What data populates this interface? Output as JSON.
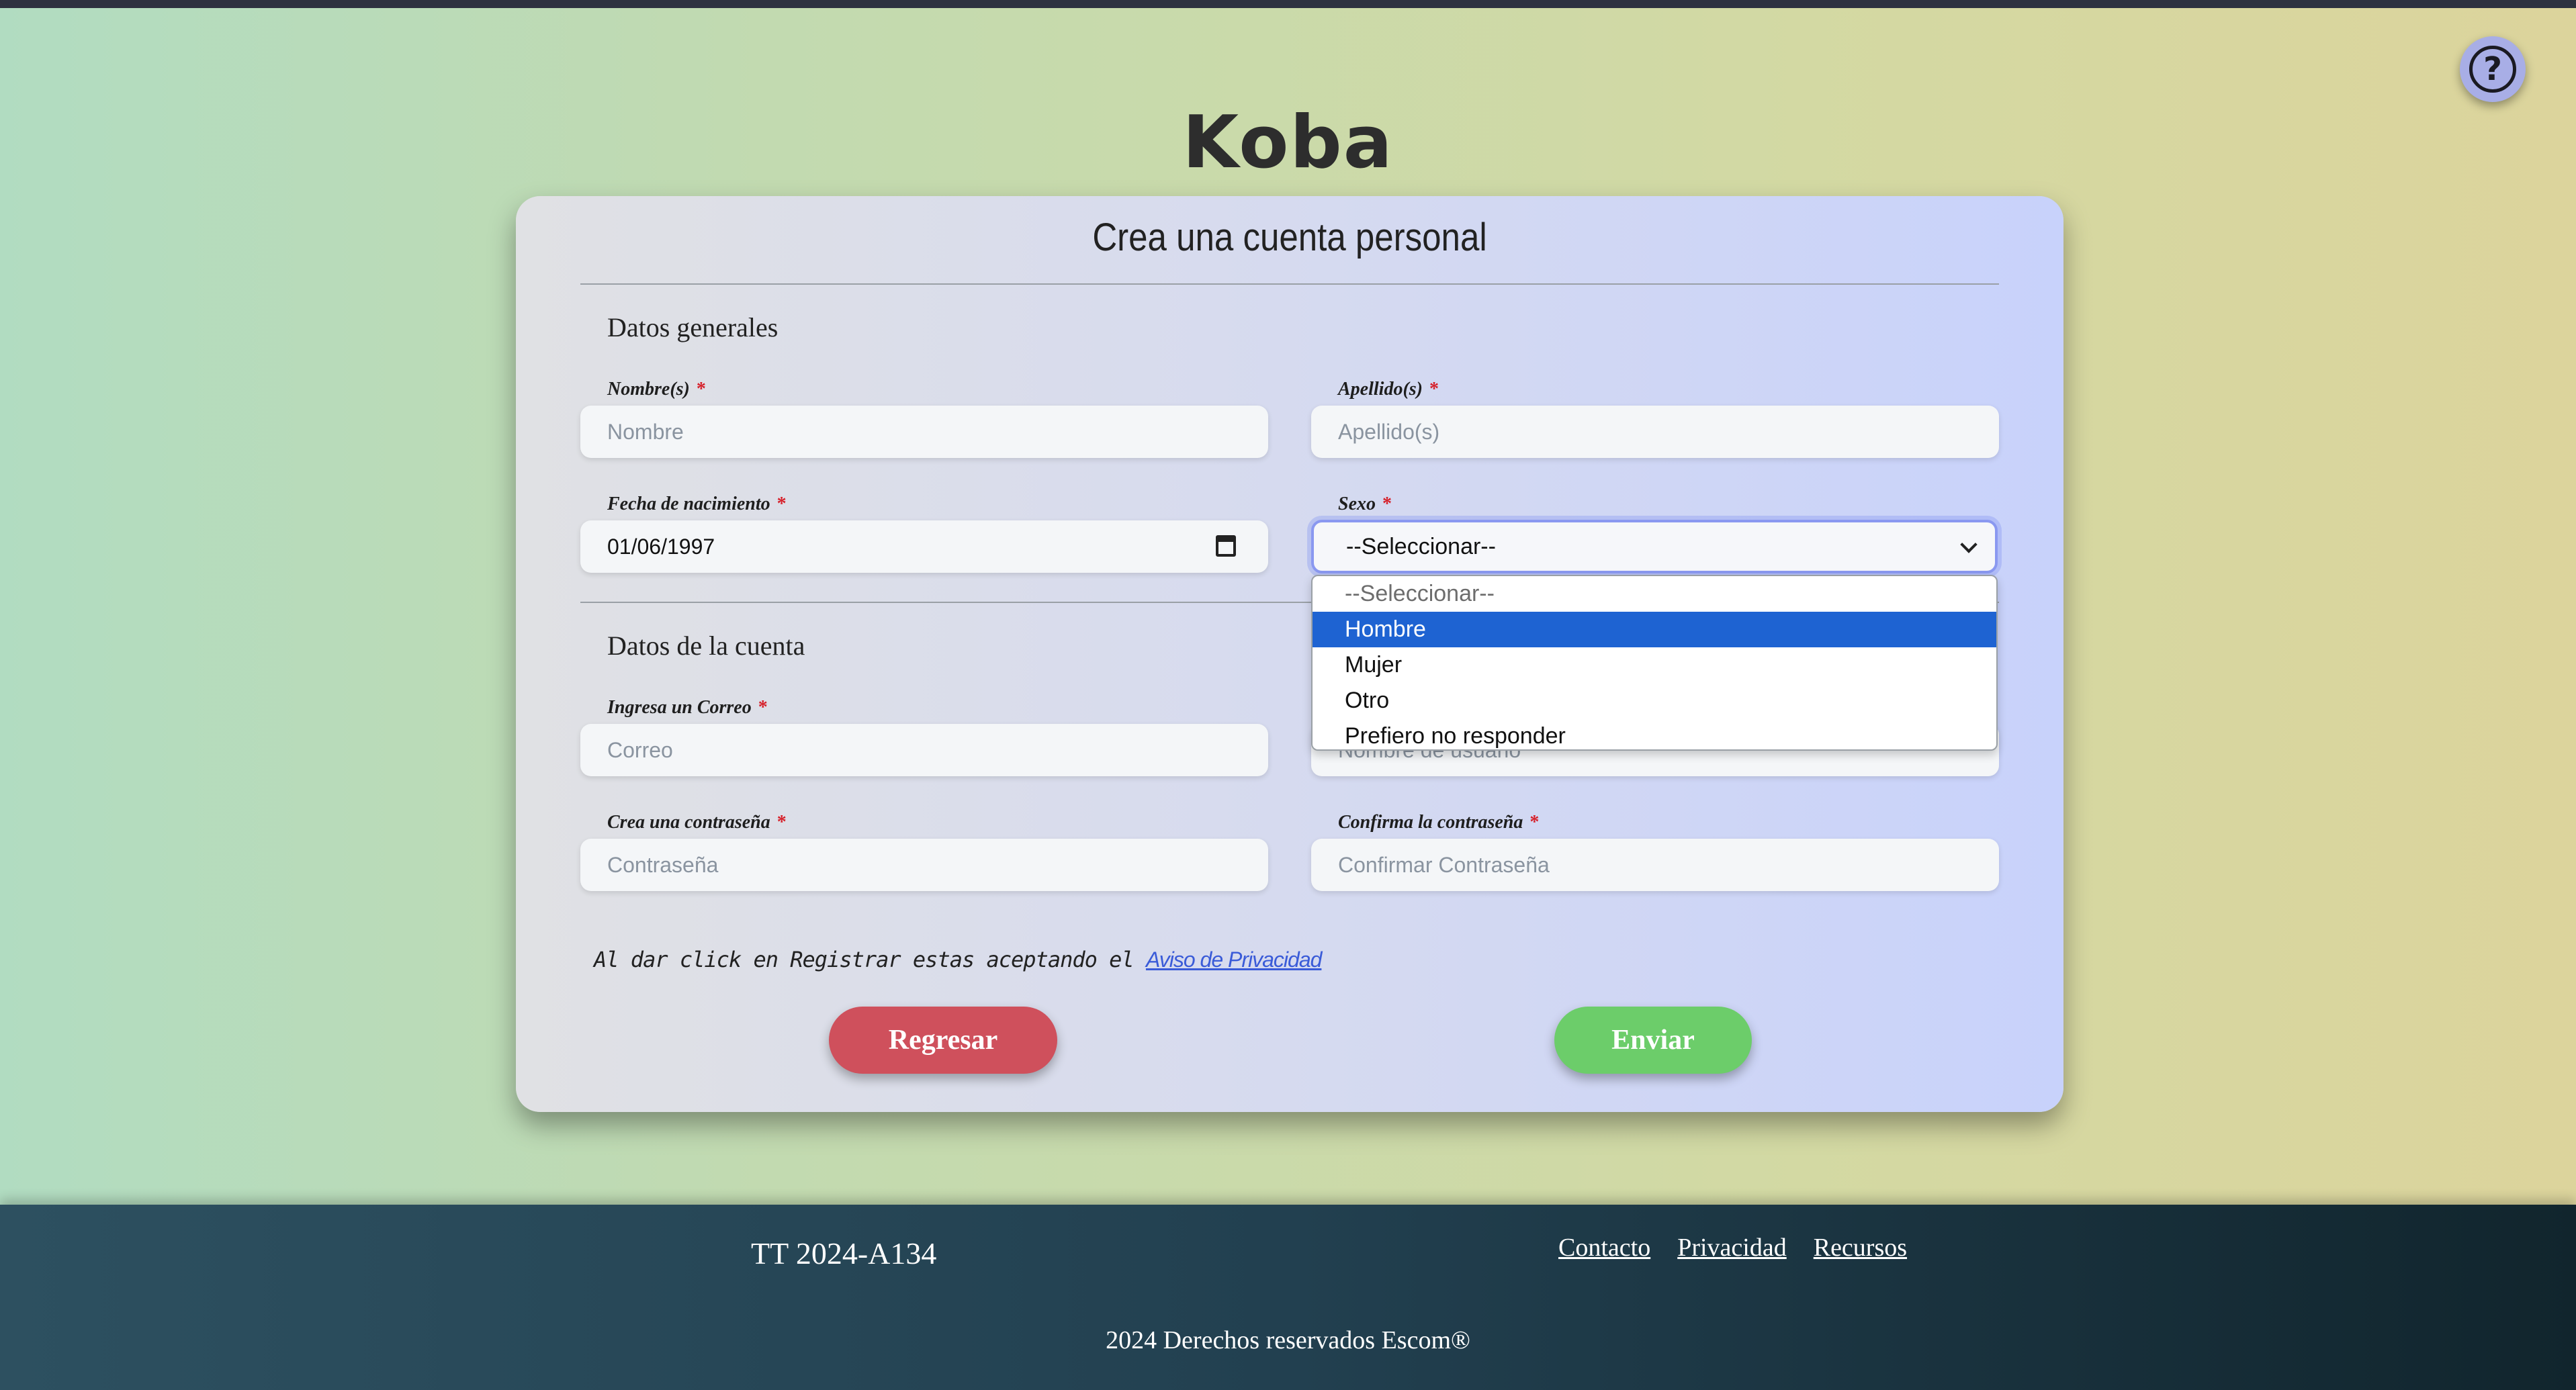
{
  "app": {
    "logo": "Koba",
    "help_symbol": "?"
  },
  "form": {
    "title": "Crea una cuenta personal",
    "required_mark": "*",
    "general_section": "Datos generales",
    "account_section": "Datos de la cuenta",
    "fields": {
      "nombre": {
        "label": "Nombre(s)",
        "placeholder": "Nombre",
        "value": ""
      },
      "apellido": {
        "label": "Apellido(s)",
        "placeholder": "Apellido(s)",
        "value": ""
      },
      "fecha": {
        "label": "Fecha de nacimiento",
        "value": "01/06/1997"
      },
      "sexo": {
        "label": "Sexo",
        "value": "--Seleccionar--",
        "options": [
          "--Seleccionar--",
          "Hombre",
          "Mujer",
          "Otro",
          "Prefiero no responder"
        ],
        "highlighted": "Hombre"
      },
      "correo": {
        "label": "Ingresa un Correo",
        "placeholder": "Correo",
        "value": ""
      },
      "usuario": {
        "placeholder": "Nombre de usuario",
        "value": ""
      },
      "contrasena": {
        "label": "Crea una contraseña",
        "placeholder": "Contraseña",
        "value": ""
      },
      "confirmar": {
        "label": "Confirma la contraseña",
        "placeholder": "Confirmar Contraseña",
        "value": ""
      }
    },
    "privacy_text": "Al dar click en Registrar estas aceptando el",
    "privacy_link": "Aviso de Privacidad",
    "back_button": "Regresar",
    "submit_button": "Enviar"
  },
  "footer": {
    "id": "TT 2024-A134",
    "links": [
      "Contacto",
      "Privacidad",
      "Recursos"
    ],
    "copyright": "2024 Derechos reservados Escom®"
  },
  "colors": {
    "back_button": "#cf505c",
    "submit_button": "#6ccd6a",
    "dropdown_highlight": "#1e63d2",
    "required": "#d6202a"
  }
}
